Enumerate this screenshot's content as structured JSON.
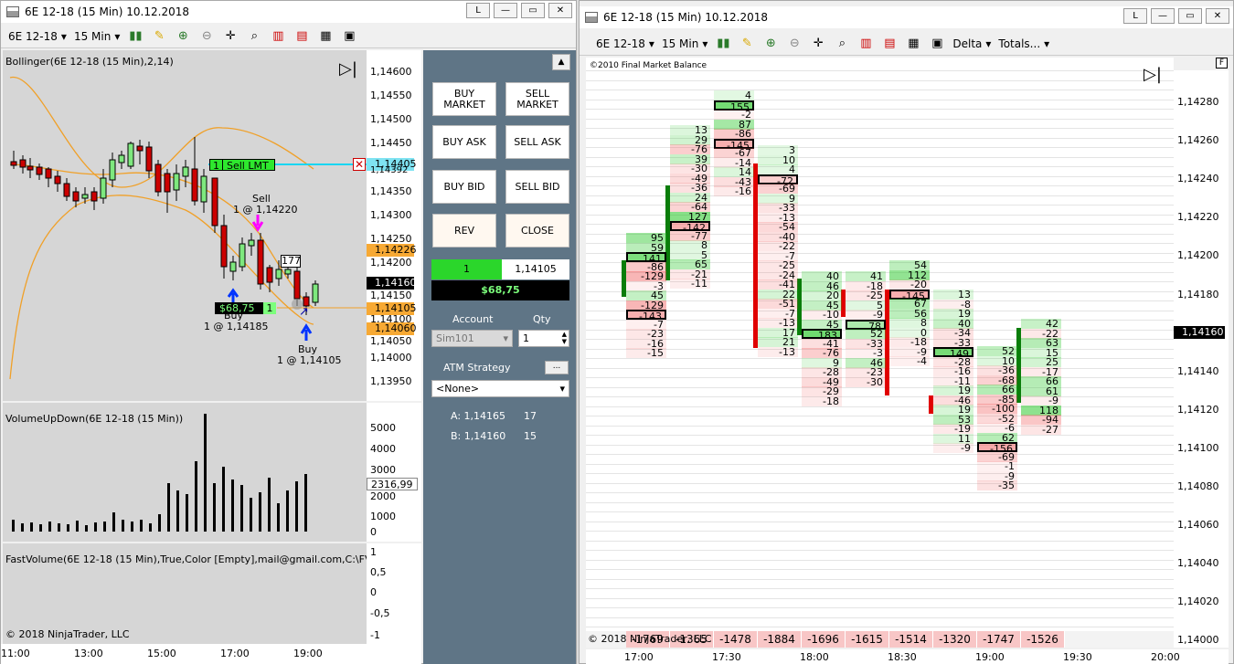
{
  "left_window": {
    "title": "6E 12-18 (15 Min)  10.12.2018",
    "window_buttons": [
      "L",
      "—",
      "▭",
      "✕"
    ],
    "toolbar": {
      "instrument": "6E 12-18",
      "timeframe": "15 Min"
    },
    "bollinger_label": "Bollinger(6E 12-18 (15 Min),2,14)",
    "volume_label": "VolumeUpDown(6E 12-18 (15 Min))",
    "fastvolume_label": "FastVolume(6E 12-18 (15 Min),True,Color [Empty],mail@gmail.com,C:\\FV\\6E.tx",
    "copyright": "© 2018 NinjaTrader, LLC",
    "price_ticks": [
      "1,14600",
      "1,14550",
      "1,14500",
      "1,14450",
      "1,14400",
      "1,14392",
      "1,14350",
      "1,14300",
      "1,14250",
      "1,14226",
      "1,14200",
      "1,14160",
      "1,14150",
      "1,14105",
      "1,14100",
      "1,14060",
      "1,14050",
      "1,14000",
      "1,13950"
    ],
    "tags": {
      "sell_lmt_price": "1,14405",
      "orange1": "1,14226",
      "current": "1,14160",
      "orange2": "1,14105",
      "orange3": "1,14060"
    },
    "volume_ticks": [
      "5000",
      "4000",
      "3000",
      "2316,99",
      "2000",
      "1000",
      "0"
    ],
    "fv_ticks": [
      "1",
      "0,5",
      "0",
      "-0,5",
      "-1"
    ],
    "time_ticks": [
      "11:00",
      "13:00",
      "15:00",
      "17:00",
      "19:00"
    ],
    "sell_lmt": {
      "qty": "1",
      "label": "Sell LMT"
    },
    "sell_note": {
      "l1": "Sell",
      "l2": "1 @ 1,14220"
    },
    "buy_note1": {
      "l1": "Buy",
      "l2": "1 @ 1,14185"
    },
    "buy_note2": {
      "l1": "Buy",
      "l2": "1 @ 1,14105"
    },
    "pnl_tag": "$68,75",
    "pos_qty": "1",
    "box_177": "177"
  },
  "order_panel": {
    "buy_market": "BUY MARKET",
    "sell_market": "SELL MARKET",
    "buy_ask": "BUY ASK",
    "sell_ask": "SELL ASK",
    "buy_bid": "BUY BID",
    "sell_bid": "SELL BID",
    "rev": "REV",
    "close": "CLOSE",
    "position_qty": "1",
    "position_price": "1,14105",
    "pnl": "$68,75",
    "account_label": "Account",
    "qty_label": "Qty",
    "account_value": "Sim101",
    "qty_value": "1",
    "atm_label": "ATM Strategy",
    "atm_value": "<None>",
    "ask_line": "A: 1,14165",
    "ask_size": "17",
    "bid_line": "B: 1,14160",
    "bid_size": "15"
  },
  "right_window": {
    "title": "6E 12-18 (15 Min)  10.12.2018",
    "toolbar": {
      "instrument": "6E 12-18",
      "timeframe": "15 Min",
      "delta": "Delta",
      "totals": "Totals..."
    },
    "corner_label": "©2010 Final Market Balance",
    "copyright": "© 2018 NinjaTrader, LLC",
    "price_ticks": [
      "1,14280",
      "1,14260",
      "1,14240",
      "1,14220",
      "1,14200",
      "1,14180",
      "1,14160",
      "1,14140",
      "1,14120",
      "1,14100",
      "1,14080",
      "1,14060",
      "1,14040",
      "1,14020",
      "1,14000"
    ],
    "current_price": "1,14160",
    "time_ticks": [
      "17:00",
      "17:30",
      "18:00",
      "18:30",
      "19:00",
      "19:30",
      "20:00"
    ],
    "totals": [
      "-1769",
      "-1365",
      "-1478",
      "-1884",
      "-1696",
      "-1615",
      "-1514",
      "-1320",
      "-1747",
      "-1526"
    ],
    "columns": [
      {
        "cells": [
          "95",
          "59",
          "141",
          "-86",
          "-129",
          "-3",
          "45",
          "-129",
          "-143",
          "-7",
          "-23",
          "-16",
          "-15"
        ]
      },
      {
        "cells": [
          "13",
          "29",
          "-76",
          "39",
          "-30",
          "-49",
          "-36",
          "24",
          "-64",
          "127",
          "-142",
          "-77",
          "8",
          "5",
          "65",
          "-21",
          "-11"
        ]
      },
      {
        "cells": [
          "4",
          "155",
          "-2",
          "87",
          "-86",
          "-145",
          "-67",
          "-14",
          "14",
          "-43",
          "-16"
        ]
      },
      {
        "cells": [
          "3",
          "10",
          "4",
          "-72",
          "-69",
          "9",
          "-33",
          "-13",
          "-54",
          "-40",
          "-22",
          "-7",
          "-25",
          "-24",
          "-41",
          "22",
          "-51",
          "-7",
          "-13",
          "17",
          "21",
          "-13"
        ]
      },
      {
        "cells": [
          "40",
          "46",
          "20",
          "45",
          "-10",
          "45",
          "183",
          "-41",
          "-76",
          "9",
          "-28",
          "-49",
          "-29",
          "-18"
        ]
      },
      {
        "cells": [
          "41",
          "-18",
          "-25",
          "5",
          "-9",
          "78",
          "52",
          "-33",
          "-3",
          "46",
          "-23",
          "-30"
        ]
      },
      {
        "cells": [
          "54",
          "112",
          "-20",
          "-145",
          "67",
          "56",
          "8",
          "0",
          "-18",
          "-9",
          "-4"
        ]
      },
      {
        "cells": [
          "13",
          "-8",
          "19",
          "40",
          "-34",
          "-33",
          "149",
          "-28",
          "-16",
          "-11",
          "19",
          "-46",
          "19",
          "53",
          "-19",
          "11",
          "-9"
        ]
      },
      {
        "cells": [
          "52",
          "10",
          "-36",
          "-68",
          "66",
          "-85",
          "-100",
          "-52",
          "-6",
          "62",
          "-156",
          "-69",
          "-1",
          "-9",
          "-35"
        ]
      },
      {
        "cells": [
          "42",
          "-22",
          "63",
          "15",
          "25",
          "-17",
          "66",
          "61",
          "-9",
          "118",
          "-94",
          "-27"
        ]
      }
    ]
  }
}
